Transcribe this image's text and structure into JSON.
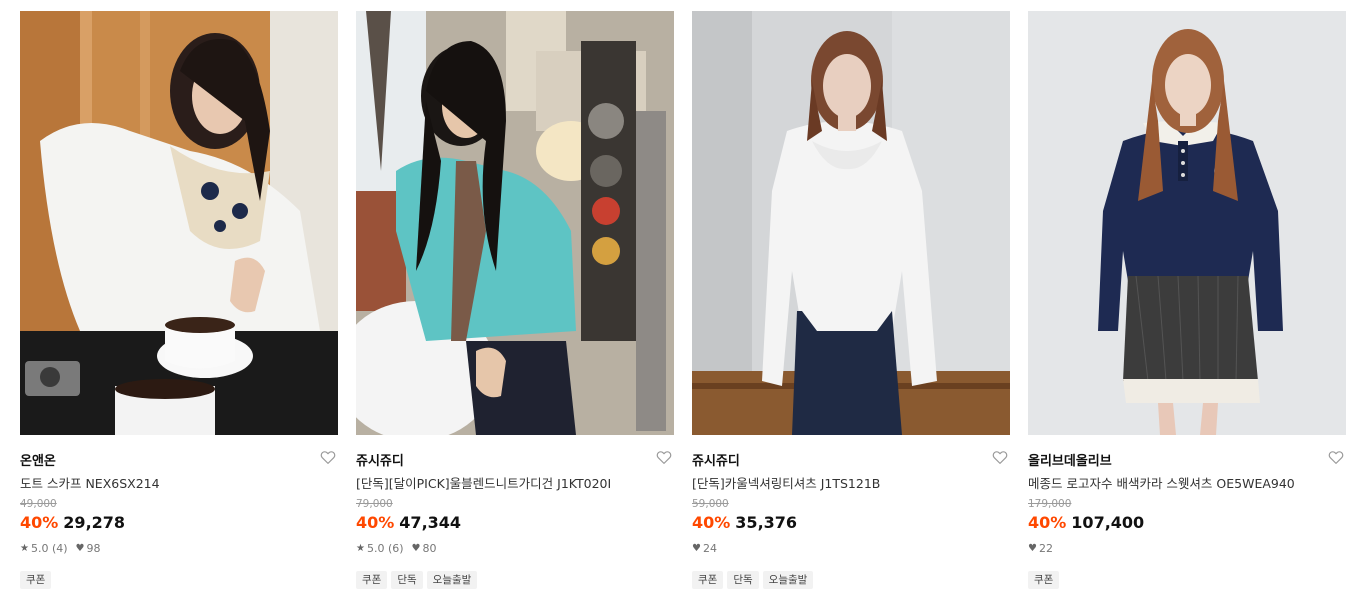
{
  "colors": {
    "discount": "#ff4800",
    "text": "#111111",
    "muted": "#9a9a9a",
    "tag_bg": "#f2f2f2"
  },
  "products": [
    {
      "brand": "온앤온",
      "title": "도트 스카프 NEX6SX214",
      "original_price": "49,000",
      "discount": "40%",
      "price": "29,278",
      "rating": "5.0 (4)",
      "likes": "98",
      "tags": [
        "쿠폰"
      ],
      "icons": {
        "rating": "star-icon",
        "likes": "heart-small-icon",
        "wishlist": "heart-outline-icon"
      }
    },
    {
      "brand": "쥬시쥬디",
      "title": "[단독][달이PICK]울블렌드니트가디건 J1KT020I",
      "original_price": "79,000",
      "discount": "40%",
      "price": "47,344",
      "rating": "5.0 (6)",
      "likes": "80",
      "tags": [
        "쿠폰",
        "단독",
        "오늘출발"
      ],
      "icons": {
        "rating": "star-icon",
        "likes": "heart-small-icon",
        "wishlist": "heart-outline-icon"
      }
    },
    {
      "brand": "쥬시쥬디",
      "title": "[단독]카울넥셔링티셔츠 J1TS121B",
      "original_price": "59,000",
      "discount": "40%",
      "price": "35,376",
      "rating": "",
      "likes": "24",
      "tags": [
        "쿠폰",
        "단독",
        "오늘출발"
      ],
      "icons": {
        "likes": "heart-small-icon",
        "wishlist": "heart-outline-icon"
      }
    },
    {
      "brand": "올리브데올리브",
      "title": "메종드 로고자수 배색카라 스웻셔츠 OE5WEA940",
      "original_price": "179,000",
      "discount": "40%",
      "price": "107,400",
      "rating": "",
      "likes": "22",
      "tags": [
        "쿠폰"
      ],
      "icons": {
        "likes": "heart-small-icon",
        "wishlist": "heart-outline-icon"
      }
    }
  ]
}
